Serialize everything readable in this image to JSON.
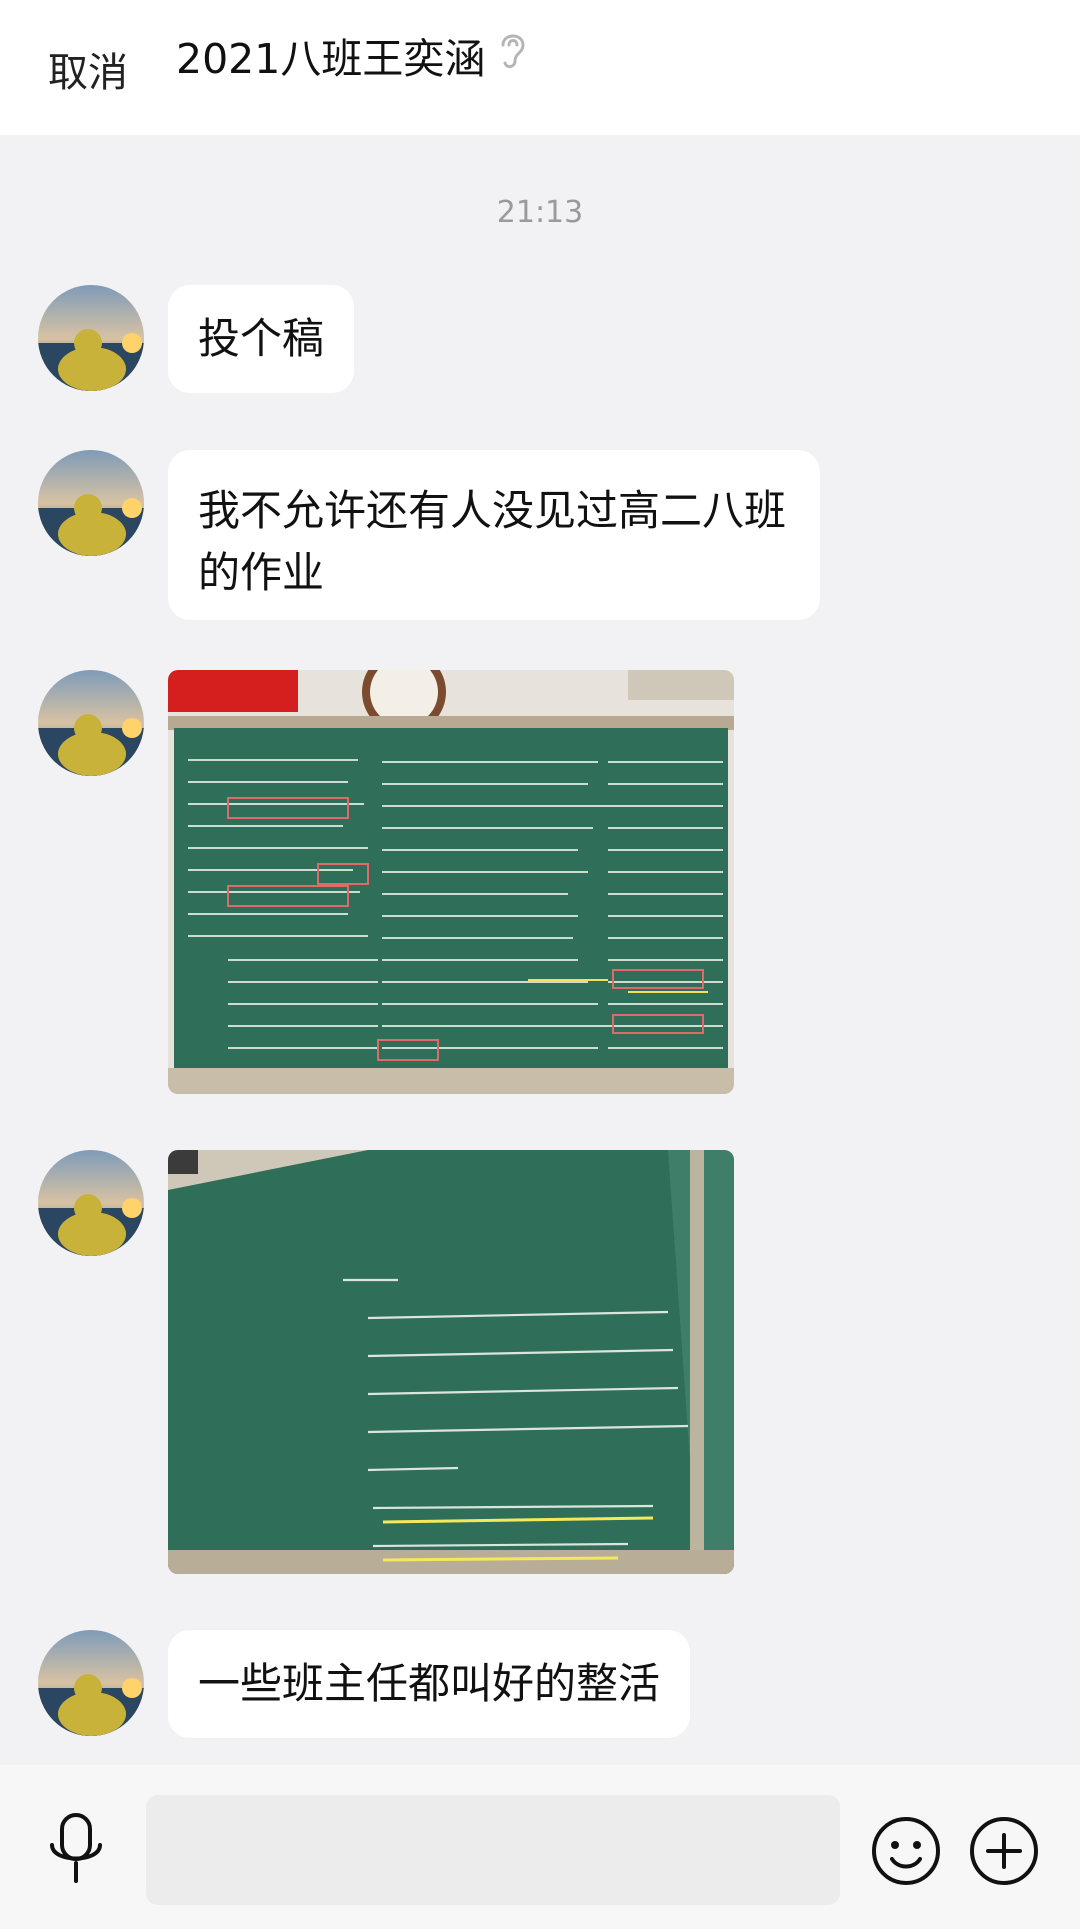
{
  "header": {
    "cancel_label": "取消",
    "title": "2021八班王奕涵",
    "voice_mode_icon": "ear-icon"
  },
  "chat": {
    "timestamp": "21:13",
    "messages": [
      {
        "type": "text",
        "text": "投个稿"
      },
      {
        "type": "text",
        "text": "我不允许还有人没见过高二八班的作业"
      },
      {
        "type": "image",
        "content": "blackboard-photo-1"
      },
      {
        "type": "image",
        "content": "blackboard-photo-2"
      },
      {
        "type": "text",
        "text": "一些班主任都叫好的整活"
      }
    ]
  },
  "footer": {
    "voice_icon": "mic-icon",
    "emoji_icon": "smile-icon",
    "more_icon": "plus-icon",
    "input_value": ""
  },
  "colors": {
    "header_bg": "#ffffff",
    "chat_bg": "#f2f1f3",
    "bubble_bg": "#ffffff",
    "chalkboard": "#2f6f5a"
  }
}
